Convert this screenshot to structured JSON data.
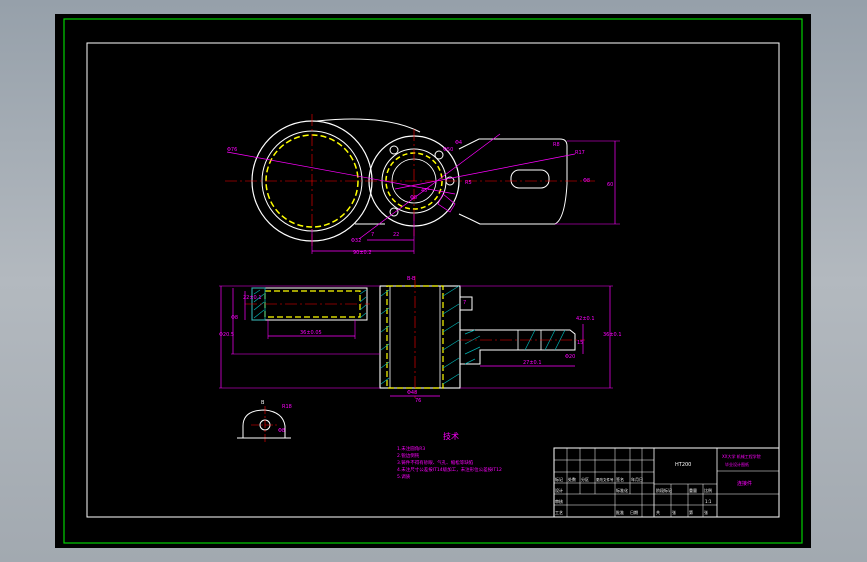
{
  "colors": {
    "background": "#000000",
    "outer_border": "#00d000",
    "frame": "#ffffff",
    "outline": "#ffffff",
    "dimension": "#ff00ff",
    "centerline": "#ff0000",
    "hidden_thread": "#ffff00",
    "hatch": "#00b0b0"
  },
  "labels": {
    "tech_title": "技术",
    "tech_notes": [
      "1.未注圆角R3",
      "2.锐边倒钝",
      "3.铸件不得有砂眼、气孔、缩松等缺陷",
      "4.未注尺寸公差按IT14级加工，未注形位公差按IT12",
      "5.调质"
    ],
    "title_block": {
      "material": "HT200",
      "company": "XX大学 机械工程学院",
      "drawing_number": "毕业设计图纸",
      "part_name": "连接件",
      "scale": "1:1",
      "row_labels": [
        "标记",
        "处数",
        "分区",
        "更改文件号",
        "签名",
        "年月日"
      ],
      "designer_row": [
        "设计",
        "标准化",
        "阶段标记",
        "重量",
        "比例"
      ],
      "review_row": [
        "审核",
        "批准",
        "共",
        "张",
        "第",
        "张"
      ],
      "process_row": [
        "工艺",
        "日期"
      ]
    },
    "dims_plan": [
      "Φ76",
      "Φ50",
      "Φ4",
      "R8",
      "R17",
      "Φ8",
      "45°",
      "Φ32",
      "7",
      "22",
      "90±0.2",
      "R5",
      "Φ8",
      "60"
    ],
    "dims_section": [
      "B-B",
      "7",
      "Φ48",
      "36±0.05",
      "27±0.1",
      "22±0.1",
      "Φ8",
      "Φ20.5",
      "42±0.1",
      "15",
      "Φ20",
      "36±0.1",
      "76"
    ],
    "dims_detail": [
      "B",
      "R18",
      "Φ8"
    ]
  }
}
